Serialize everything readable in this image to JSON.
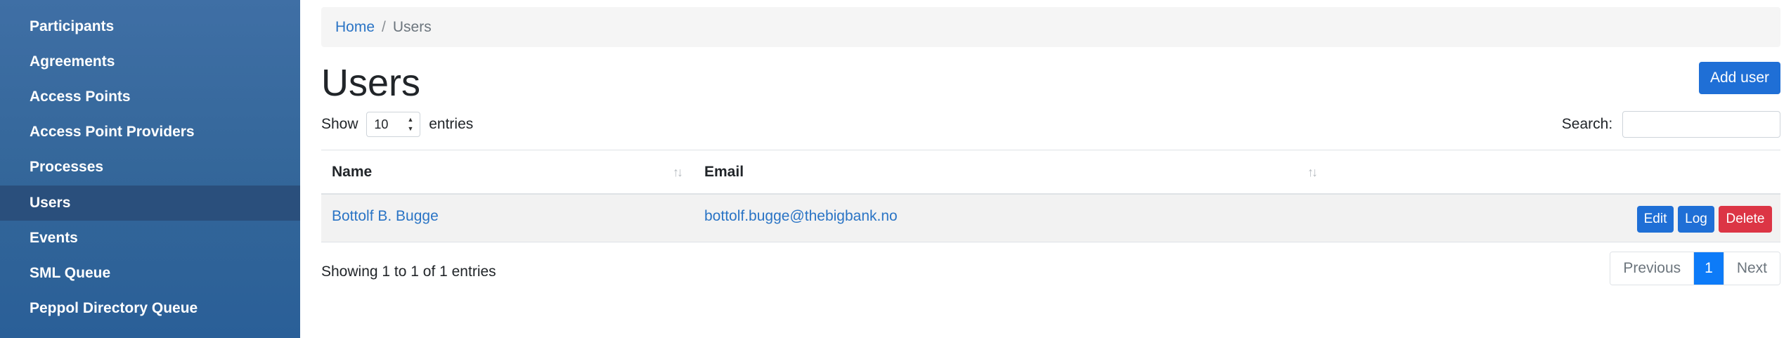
{
  "sidebar": {
    "items": [
      {
        "label": "Participants",
        "active": false
      },
      {
        "label": "Agreements",
        "active": false
      },
      {
        "label": "Access Points",
        "active": false
      },
      {
        "label": "Access Point Providers",
        "active": false
      },
      {
        "label": "Processes",
        "active": false
      },
      {
        "label": "Users",
        "active": true
      },
      {
        "label": "Events",
        "active": false
      },
      {
        "label": "SML Queue",
        "active": false
      },
      {
        "label": "Peppol Directory Queue",
        "active": false
      }
    ]
  },
  "breadcrumb": {
    "home": "Home",
    "separator": "/",
    "current": "Users"
  },
  "page": {
    "title": "Users",
    "add_user_label": "Add user"
  },
  "length": {
    "show": "Show",
    "value": "10",
    "entries": "entries"
  },
  "search": {
    "label": "Search:",
    "value": ""
  },
  "table": {
    "columns": [
      {
        "label": "Name",
        "sortable": true
      },
      {
        "label": "Email",
        "sortable": true
      }
    ],
    "rows": [
      {
        "name": "Bottolf B. Bugge",
        "email": "bottolf.bugge@thebigbank.no"
      }
    ],
    "actions": {
      "edit": "Edit",
      "log": "Log",
      "delete": "Delete"
    }
  },
  "info": "Showing 1 to 1 of 1 entries",
  "pagination": {
    "previous": "Previous",
    "current": "1",
    "next": "Next"
  },
  "colors": {
    "sidebar": "#336699",
    "active_item": "#2a4f7c",
    "primary": "#1f6fd6",
    "danger": "#dc3545",
    "link": "#2a74c5",
    "page_active": "#0d7bf8"
  }
}
